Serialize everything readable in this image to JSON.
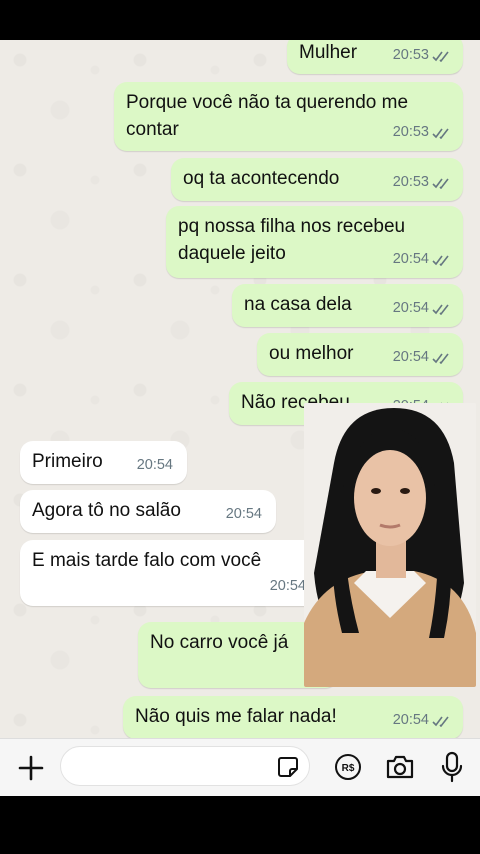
{
  "messages": [
    {
      "text": "Mulher",
      "time": "20:53"
    },
    {
      "text": "Porque você não ta querendo me contar",
      "time": "20:53"
    },
    {
      "text": "oq ta acontecendo",
      "time": "20:53"
    },
    {
      "text": "pq nossa filha nos recebeu daquele jeito",
      "time": "20:54"
    },
    {
      "text": "na casa dela",
      "time": "20:54"
    },
    {
      "text": "ou melhor",
      "time": "20:54"
    },
    {
      "text": "Não recebeu",
      "time": "20:54"
    },
    {
      "text": "Primeiro",
      "time": "20:54"
    },
    {
      "text": "Agora tô no salão",
      "time": "20:54"
    },
    {
      "text": "E mais tarde falo com você",
      "time": "20:54"
    },
    {
      "text": "No carro você já",
      "time": ""
    },
    {
      "text": "Não quis me falar nada!",
      "time": "20:54"
    }
  ],
  "input": {
    "placeholder": ""
  },
  "icons": {
    "add": "plus-icon",
    "sticker": "sticker-icon",
    "payment": "pix-rs-icon",
    "camera": "camera-icon",
    "mic": "microphone-icon"
  },
  "colors": {
    "outgoing": "#dcf8c6",
    "incoming": "#ffffff",
    "read_ticks": "#667781",
    "chat_bg": "#eeebe6"
  }
}
